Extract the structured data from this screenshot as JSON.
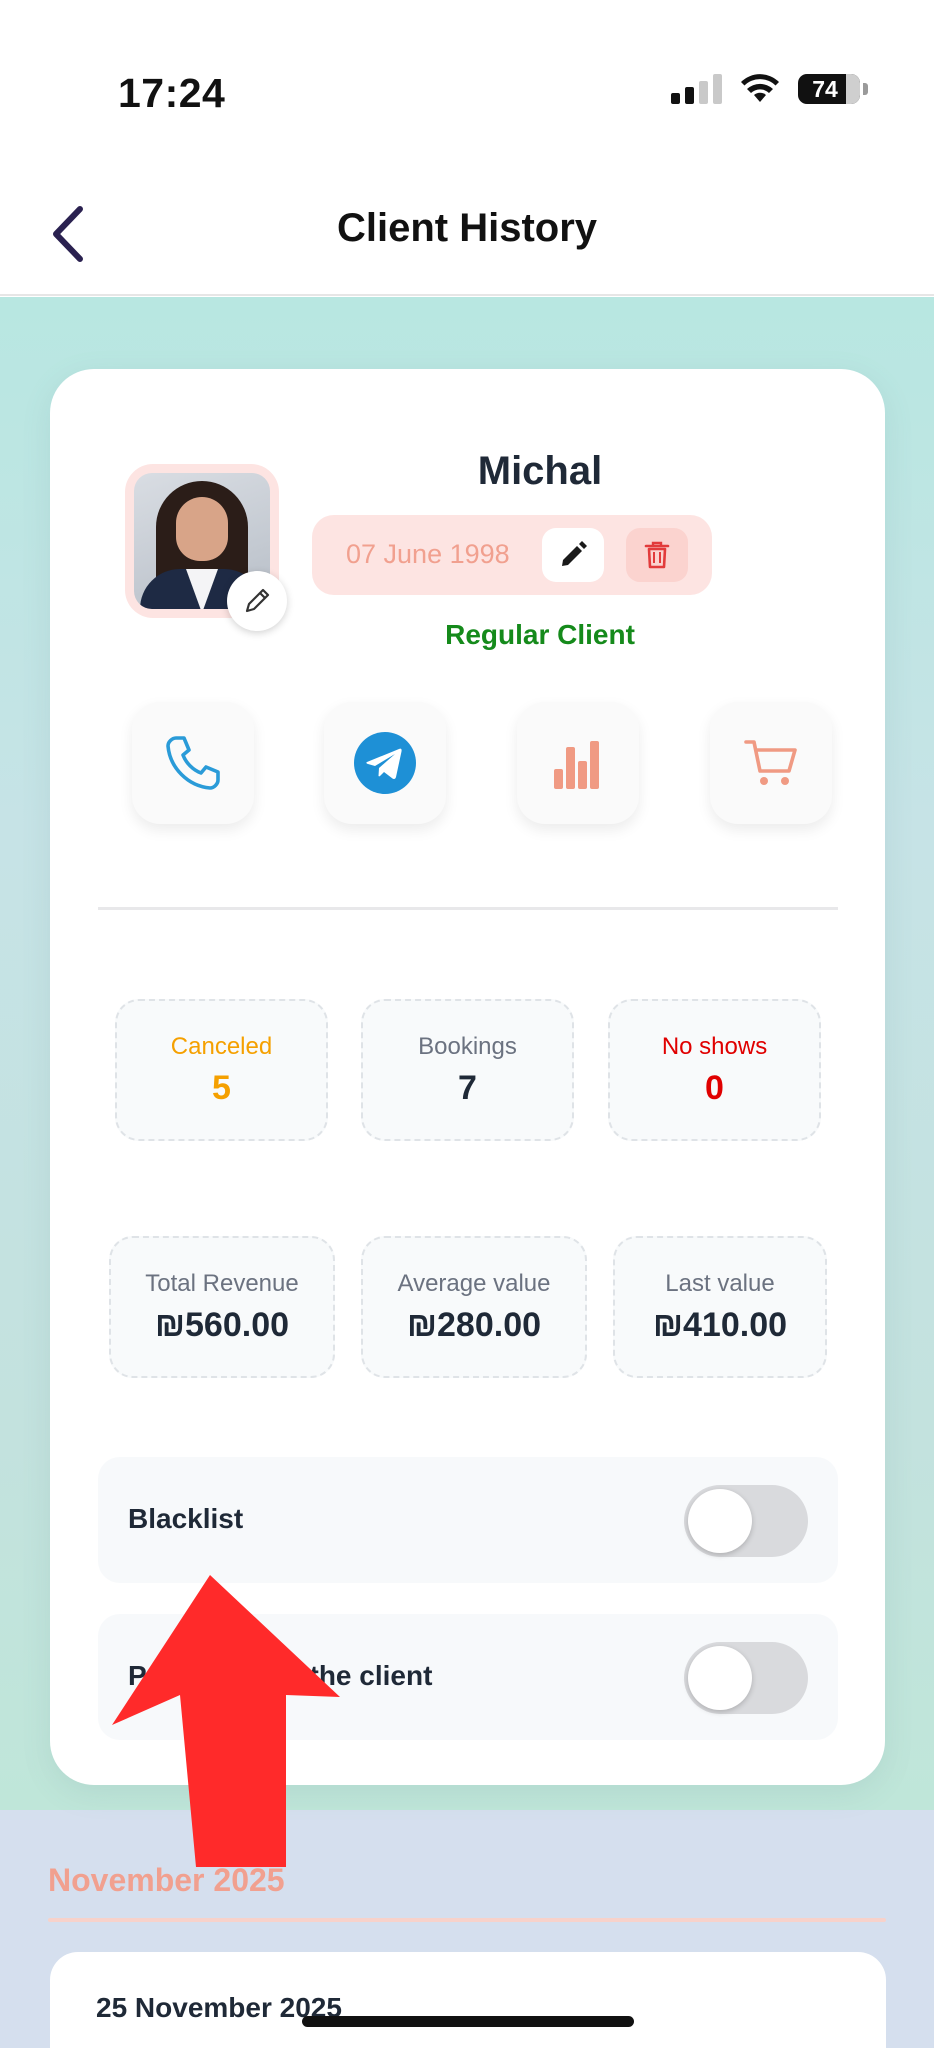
{
  "status_bar": {
    "time": "17:24",
    "battery": "74"
  },
  "nav": {
    "title": "Client History"
  },
  "client": {
    "name": "Michal",
    "dob": "07 June 1998",
    "type": "Regular Client",
    "type_color": "#158a1b"
  },
  "actions": [
    {
      "icon": "phone-icon"
    },
    {
      "icon": "telegram-icon"
    },
    {
      "icon": "bar-chart-icon"
    },
    {
      "icon": "cart-icon"
    }
  ],
  "stats": {
    "canceled": {
      "label": "Canceled",
      "value": "5",
      "color": "#f5a000"
    },
    "bookings": {
      "label": "Bookings",
      "value": "7"
    },
    "no_shows": {
      "label": "No shows",
      "value": "0",
      "color": "#e00000"
    }
  },
  "revenue": {
    "total": {
      "label": "Total Revenue",
      "value": "₪560.00"
    },
    "average": {
      "label": "Average value",
      "value": "₪280.00"
    },
    "last": {
      "label": "Last value",
      "value": "₪410.00"
    }
  },
  "toggles": {
    "blacklist": {
      "label": "Blacklist",
      "on": false
    },
    "second": {
      "label": "P            it for the client",
      "on": false
    }
  },
  "history": {
    "month": "November 2025",
    "entries": [
      {
        "date": "25 November 2025"
      }
    ]
  },
  "colors": {
    "accent": "#f1a08f",
    "teal_bg": "#b8e7e1"
  }
}
